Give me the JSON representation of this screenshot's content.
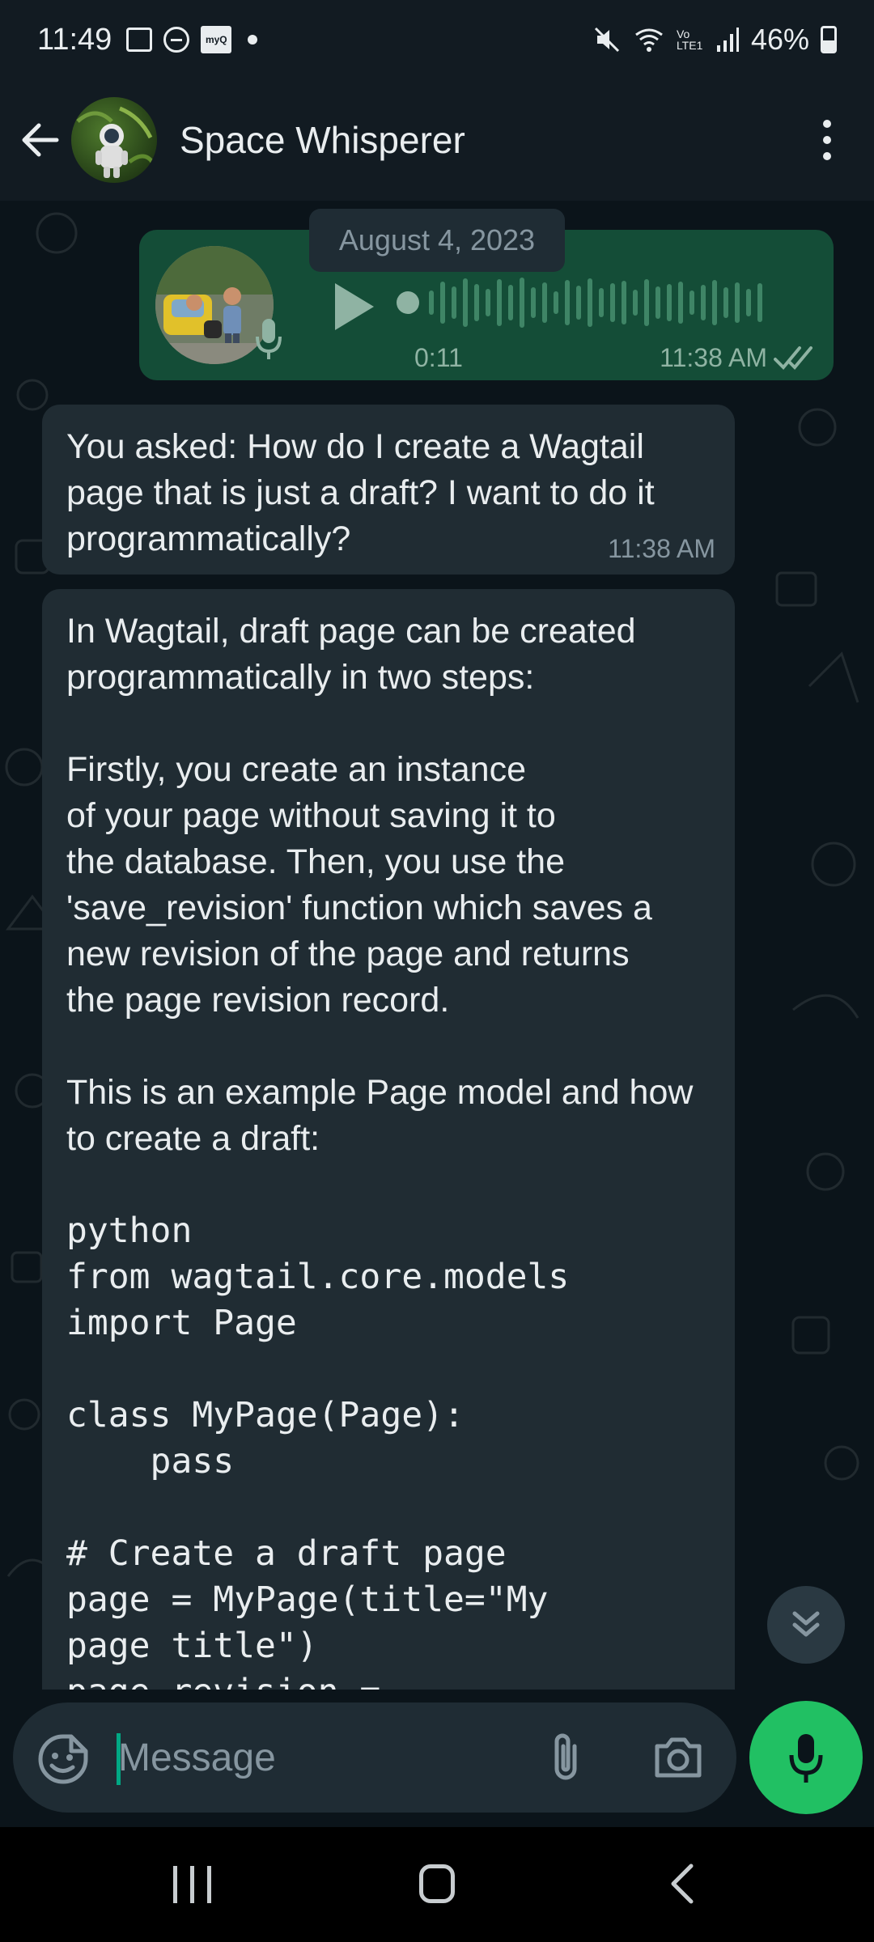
{
  "status_bar": {
    "time": "11:49",
    "battery_text": "46%",
    "battery_level": 0.46,
    "notification_icons": [
      "gallery-icon",
      "do-not-disturb-icon",
      "myq-app-icon",
      "dot-icon"
    ],
    "system_icons": [
      "mute-icon",
      "wifi-icon",
      "volte-icon",
      "signal-icon",
      "battery-icon"
    ],
    "myq_label": "myQ",
    "volte_label": "Vo LTE1"
  },
  "header": {
    "contact_name": "Space Whisperer",
    "back_icon": "arrow-left-icon",
    "menu_icon": "more-vertical-icon"
  },
  "chat": {
    "date_chip": "August 4, 2023",
    "voice_message": {
      "duration": "0:11",
      "time": "11:38 AM",
      "read_status": "double-check-icon",
      "progress": 0
    },
    "message_1": {
      "text": "You asked: How do I create a Wagtail page that is just a draft? I want to do it programmatically?",
      "time": "11:38 AM"
    },
    "message_2": {
      "para_1": "In Wagtail, draft page can be created programmatically in two steps:",
      "para_2": "Firstly, you create an instance\nof your page without saving it to\nthe database. Then, you use the\n'save_revision' function which saves a\nnew revision of the page and returns\nthe page revision record.",
      "para_3": "This is an example Page model and how to create a draft:",
      "code": "python\nfrom wagtail.core.models\nimport Page\n\nclass MyPage(Page):\n    pass\n\n# Create a draft page\npage = MyPage(title=\"My\npage title\")\npage_revision ="
    }
  },
  "input_bar": {
    "placeholder": "Message",
    "value": ""
  },
  "colors": {
    "background": "#0b141a",
    "header": "#121b22",
    "incoming_bubble": "#202c33",
    "outgoing_bubble": "#144d37",
    "accent": "#21c063",
    "secondary_text": "#8696a0"
  }
}
